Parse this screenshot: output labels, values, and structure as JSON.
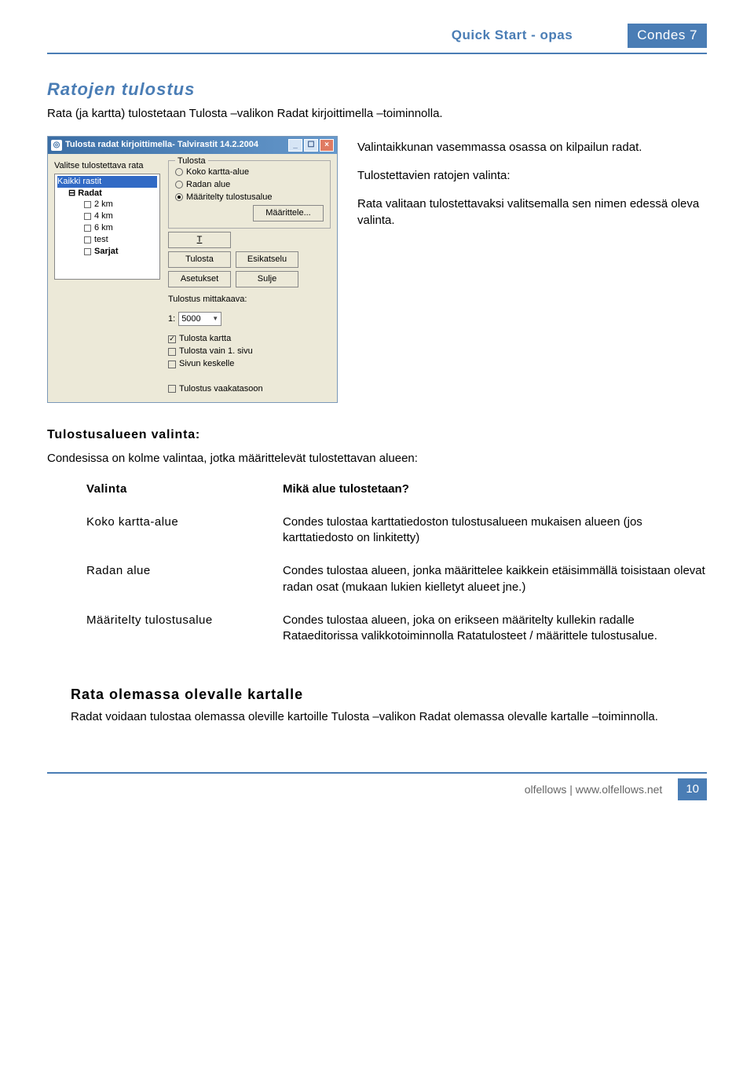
{
  "header": {
    "title": "Quick Start - opas",
    "product": "Condes 7"
  },
  "section1": {
    "heading": "Ratojen tulostus",
    "intro": "Rata (ja kartta) tulostetaan Tulosta –valikon Radat kirjoittimella –toiminnolla."
  },
  "dialog": {
    "title": "Tulosta radat kirjoittimella- Talvirastit 14.2.2004",
    "left_label": "Valitse tulostettava rata",
    "tree": {
      "root": "Kaikki rastit",
      "group": "Radat",
      "items": [
        "2 km",
        "4 km",
        "6 km",
        "test",
        "Sarjat"
      ]
    },
    "area_group": "Tulosta",
    "radios": [
      "Koko kartta-alue",
      "Radan alue",
      "Määritelty tulostusalue"
    ],
    "define_btn": "Määrittele...",
    "buttons": {
      "print": "Tulosta",
      "preview": "Esikatselu",
      "settings": "Asetukset",
      "close": "Sulje"
    },
    "scale_label": "Tulostus mittakaava:",
    "scale_prefix": "1:",
    "scale_value": "5000",
    "checks": [
      "Tulosta kartta",
      "Tulosta vain 1. sivu",
      "Sivun keskelle"
    ],
    "landscape": "Tulostus vaakatasoon"
  },
  "right_col": {
    "p1": "Valintaikkunan vasemmassa osassa on kilpailun radat.",
    "p2": "Tulostettavien ratojen valinta:",
    "p3": "Rata valitaan tulostettavaksi valitsemalla sen nimen edessä oleva valinta."
  },
  "section2": {
    "heading": "Tulostusalueen valinta:",
    "lead": "Condesissa on kolme valintaa, jotka määrittelevät tulostettavan alueen:"
  },
  "table": {
    "head_term": "Valinta",
    "head_desc": "Mikä alue tulostetaan?",
    "rows": [
      {
        "term": "Koko kartta-alue",
        "desc": "Condes tulostaa karttatiedoston tulostusalueen mukaisen alueen (jos karttatiedosto on linkitetty)"
      },
      {
        "term": "Radan alue",
        "desc": "Condes tulostaa alueen, jonka määrittelee kaikkein etäisimmällä toisistaan olevat radan osat (mukaan lukien kielletyt alueet jne.)"
      },
      {
        "term": "Määritelty tulostusalue",
        "desc": "Condes tulostaa alueen, joka on erikseen määritelty kullekin radalle Rataeditorissa valikkotoiminnolla Ratatulosteet / määrittele tulostusalue."
      }
    ]
  },
  "section3": {
    "heading": "Rata olemassa olevalle kartalle",
    "body": "Radat voidaan tulostaa olemassa oleville kartoille Tulosta –valikon Radat olemassa olevalle kartalle –toiminnolla."
  },
  "footer": {
    "credit": "olfellows | www.olfellows.net",
    "page": "10"
  }
}
